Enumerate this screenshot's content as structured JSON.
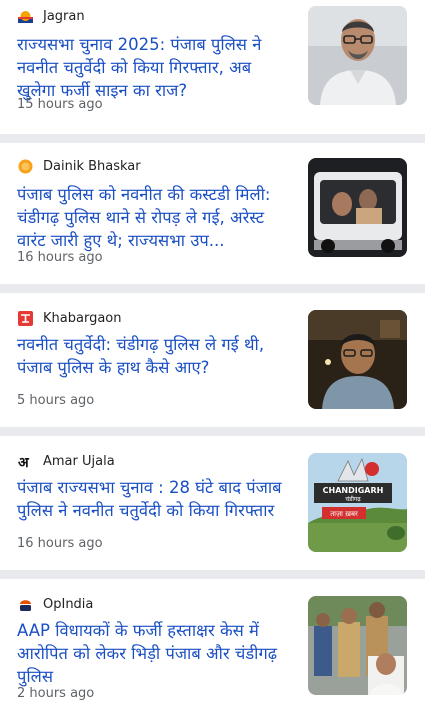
{
  "articles": [
    {
      "source": "Jagran",
      "source_logo": "jagran-logo-icon",
      "headline": "राज्यसभा चुनाव 2025: पंजाब पुलिस ने नवनीत चतुर्वेदी को किया गिरफ्तार, अब खुलेगा फर्जी साइन का राज?",
      "time": "15 hours ago",
      "thumbnail": "man-with-glasses-photo"
    },
    {
      "source": "Dainik Bhaskar",
      "source_logo": "dainik-bhaskar-logo-icon",
      "headline": "पंजाब पुलिस को नवनीत की कस्टडी मिली: चंडीगढ़ पुलिस थाने से रोपड़ ले गई, अरेस्ट वारंट जारी हुए थे; राज्यसभा उप...",
      "time": "16 hours ago",
      "thumbnail": "police-vehicle-photo"
    },
    {
      "source": "Khabargaon",
      "source_logo": "khabargaon-logo-icon",
      "headline": "नवनीत चतुर्वेदी: चंडीगढ़ पुलिस ले गई थी, पंजाब पुलिस के हाथ कैसे आए?",
      "time": "5 hours ago",
      "thumbnail": "man-in-car-photo"
    },
    {
      "source": "Amar Ujala",
      "source_logo": "amar-ujala-logo-icon",
      "headline": "पंजाब राज्यसभा चुनाव : 28 घंटे बाद पंजाब पुलिस ने नवनीत चतुर्वेदी को किया गिरफ्तार",
      "time": "16 hours ago",
      "thumbnail": "chandigarh-sign-photo",
      "thumbnail_text": {
        "sign": "CHANDIGARH",
        "sign_sub": "चंडीगढ़",
        "badge": "ताज़ा ख़बर"
      }
    },
    {
      "source": "OpIndia",
      "source_logo": "opindia-logo-icon",
      "headline": "AAP विधायकों के फर्जी हस्ताक्षर केस में आरोपित को लेकर भिड़ी पंजाब और चंडीगढ़ पुलिस",
      "time": "2 hours ago",
      "thumbnail": "police-crowd-photo"
    }
  ],
  "colors": {
    "headline": "#1a4fc4",
    "time": "#5f6368",
    "divider": "#e9eaee"
  }
}
